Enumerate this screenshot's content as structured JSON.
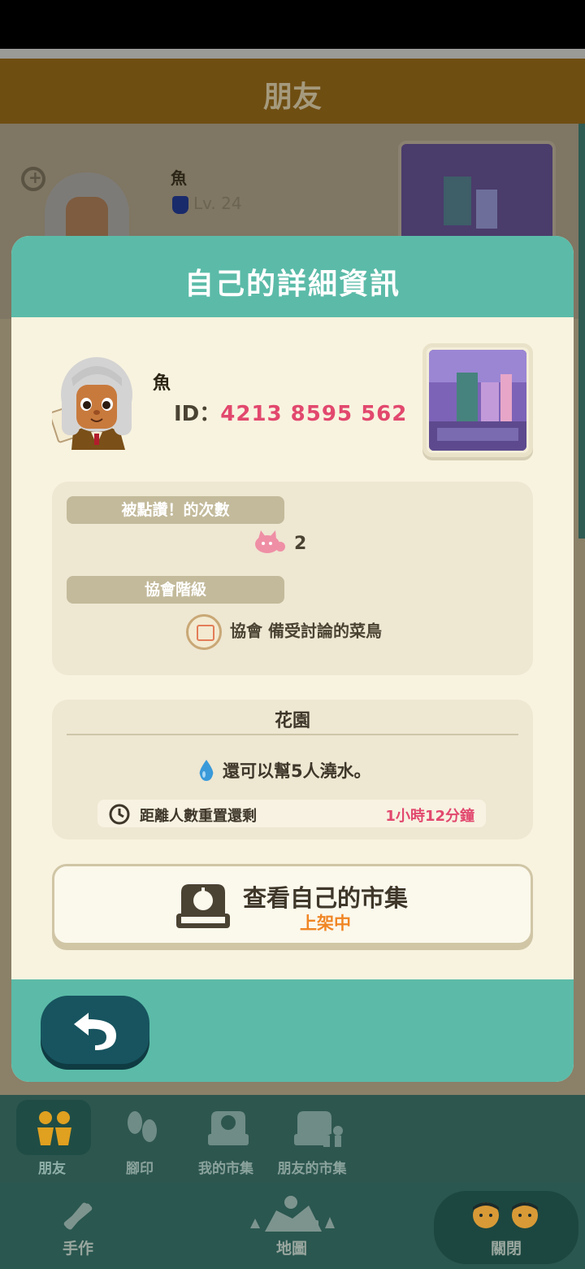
{
  "header": {
    "title": "朋友"
  },
  "background_card": {
    "name": "魚",
    "level": "Lv. 24"
  },
  "modal": {
    "title": "自己的詳細資訊",
    "profile": {
      "name": "魚",
      "id_label": "ID：",
      "id_value": "4213 8595 562"
    },
    "likes": {
      "label": "被點讚！的次數",
      "count": "2"
    },
    "rank": {
      "label": "協會階級",
      "value": "協會 備受討論的菜鳥"
    },
    "garden": {
      "title": "花園",
      "water_text": "還可以幫5人澆水。",
      "reset_label": "距離人數重置還剩",
      "reset_value": "1小時12分鐘"
    },
    "market_button": {
      "label": "查看自己的市集",
      "status": "上架中"
    }
  },
  "tabs": [
    {
      "label": "朋友",
      "icon": "friends-icon",
      "active": true
    },
    {
      "label": "腳印",
      "icon": "footprints-icon",
      "active": false
    },
    {
      "label": "我的市集",
      "icon": "market-icon",
      "active": false
    },
    {
      "label": "朋友的市集",
      "icon": "friend-market-icon",
      "active": false
    }
  ],
  "bottom_nav": [
    {
      "label": "手作",
      "icon": "craft-icon"
    },
    {
      "label": "地圖",
      "icon": "map-icon"
    },
    {
      "label": "關閉",
      "icon": "close-people-icon"
    }
  ],
  "colors": {
    "teal": "#5bbba8",
    "accent_pink": "#e2486e",
    "accent_orange": "#f08523",
    "modal_bg": "#f8f3df",
    "dark_teal": "#17545f"
  }
}
